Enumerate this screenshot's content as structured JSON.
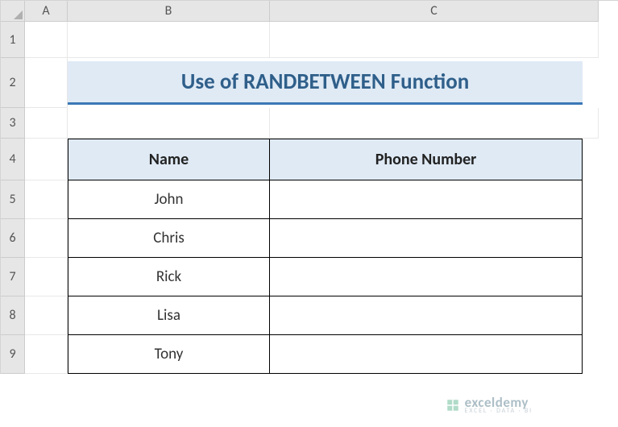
{
  "columns": [
    "A",
    "B",
    "C"
  ],
  "rows": [
    "1",
    "2",
    "3",
    "4",
    "5",
    "6",
    "7",
    "8",
    "9"
  ],
  "title": "Use of RANDBETWEEN Function",
  "table": {
    "headers": {
      "name": "Name",
      "phone": "Phone Number"
    },
    "data": [
      {
        "name": "John",
        "phone": ""
      },
      {
        "name": "Chris",
        "phone": ""
      },
      {
        "name": "Rick",
        "phone": ""
      },
      {
        "name": "Lisa",
        "phone": ""
      },
      {
        "name": "Tony",
        "phone": ""
      }
    ]
  },
  "watermark": {
    "brand": "exceldemy",
    "sub": "EXCEL · DATA · BI"
  }
}
